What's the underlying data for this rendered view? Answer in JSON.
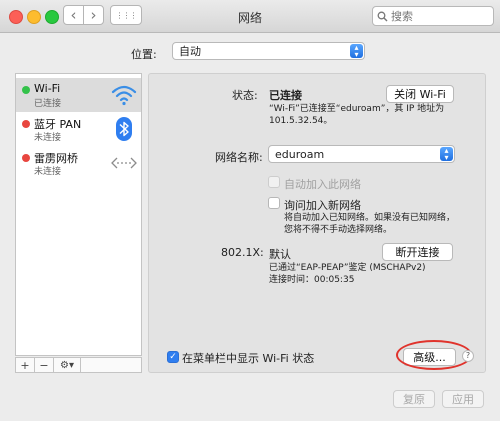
{
  "window": {
    "title": "网络"
  },
  "toolbar": {
    "back_glyph": "‹",
    "forward_glyph": "›",
    "grid_glyph": "⋮⋮⋮"
  },
  "search": {
    "placeholder": "搜索"
  },
  "location": {
    "label": "位置:",
    "value": "自动"
  },
  "sidebar": {
    "items": [
      {
        "name": "Wi-Fi",
        "status": "已连接",
        "status_color": "#33c24a",
        "icon": "wifi-icon",
        "selected": true
      },
      {
        "name": "蓝牙 PAN",
        "status": "未连接",
        "status_color": "#e8463f",
        "icon": "bluetooth-icon",
        "selected": false
      },
      {
        "name": "雷雳网桥",
        "status": "未连接",
        "status_color": "#e8463f",
        "icon": "thunderbolt-bridge-icon",
        "selected": false
      }
    ],
    "footer": {
      "add": "+",
      "remove": "−",
      "action": "⚙▾"
    }
  },
  "detail": {
    "status_label": "状态:",
    "status_value": "已连接",
    "turn_off_button": "关闭 Wi-Fi",
    "status_desc": "“Wi-Fi”已连接至“eduroam”，其 IP 地址为 101.5.32.54。",
    "network_name_label": "网络名称:",
    "network_name_value": "eduroam",
    "auto_join_label": "自动加入此网络",
    "ask_join_label": "询问加入新网络",
    "ask_join_desc": "将自动加入已知网络。如果没有已知网络，您将不得不手动选择网络。",
    "dot1x_label": "802.1X:",
    "dot1x_value": "默认",
    "disconnect_button": "断开连接",
    "dot1x_desc_1": "已通过“EAP-PEAP”鉴定 (MSCHAPv2)",
    "dot1x_desc_2": "连接时间：00:05:35",
    "show_menu_label": "在菜单栏中显示 Wi-Fi 状态",
    "advanced_button": "高级...",
    "help_glyph": "?"
  },
  "footer": {
    "revert_button": "复原",
    "apply_button": "应用"
  },
  "colors": {
    "accent": "#2f7ef0",
    "annotation": "#e0332c"
  }
}
